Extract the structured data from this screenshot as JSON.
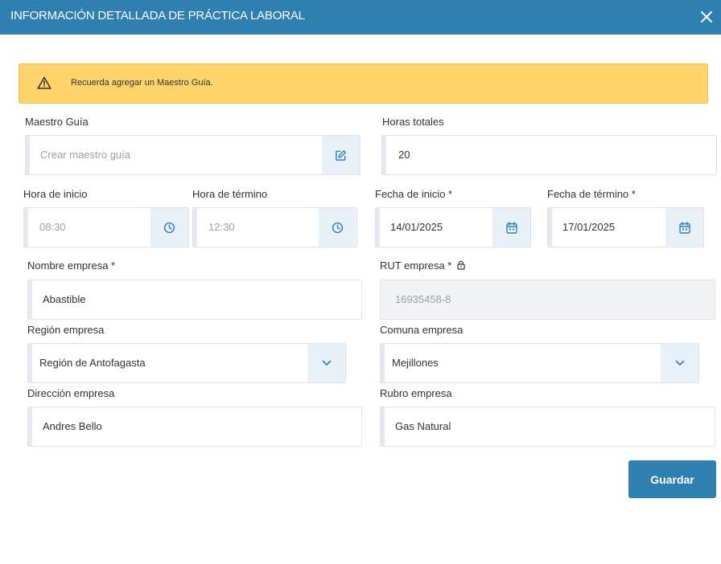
{
  "header": {
    "title": "INFORMACIÓN DETALLADA DE PRÁCTICA LABORAL"
  },
  "alert": {
    "text": "Recuerda agregar un Maestro Guía."
  },
  "form": {
    "maestro_guia": {
      "label": "Maestro Guía",
      "placeholder": "Crear maestro guía"
    },
    "horas_totales": {
      "label": "Horas totales",
      "value": "20"
    },
    "hora_inicio": {
      "label": "Hora de inicio",
      "value": "08:30"
    },
    "hora_termino": {
      "label": "Hora de término",
      "value": "12:30"
    },
    "fecha_inicio": {
      "label": "Fecha de inicio *",
      "value": "14/01/2025"
    },
    "fecha_termino": {
      "label": "Fecha de término *",
      "value": "17/01/2025"
    },
    "nombre_empresa": {
      "label": "Nombre empresa *",
      "value": "Abastible"
    },
    "rut_empresa": {
      "label": "RUT empresa *",
      "value": "16935458-8"
    },
    "region_empresa": {
      "label": "Región empresa",
      "value": "Región de Antofagasta"
    },
    "comuna_empresa": {
      "label": "Comuna empresa",
      "value": "Mejillones"
    },
    "direccion_empresa": {
      "label": "Dirección empresa",
      "value": "Andres Bello"
    },
    "rubro_empresa": {
      "label": "Rubro empresa",
      "value": "Gas Natural"
    }
  },
  "actions": {
    "save_label": "Guardar"
  },
  "colors": {
    "primary": "#2f7fb0",
    "warning": "#ffd36b",
    "addon_bg": "#e9f1f8",
    "disabled_bg": "#f2f3f5"
  }
}
